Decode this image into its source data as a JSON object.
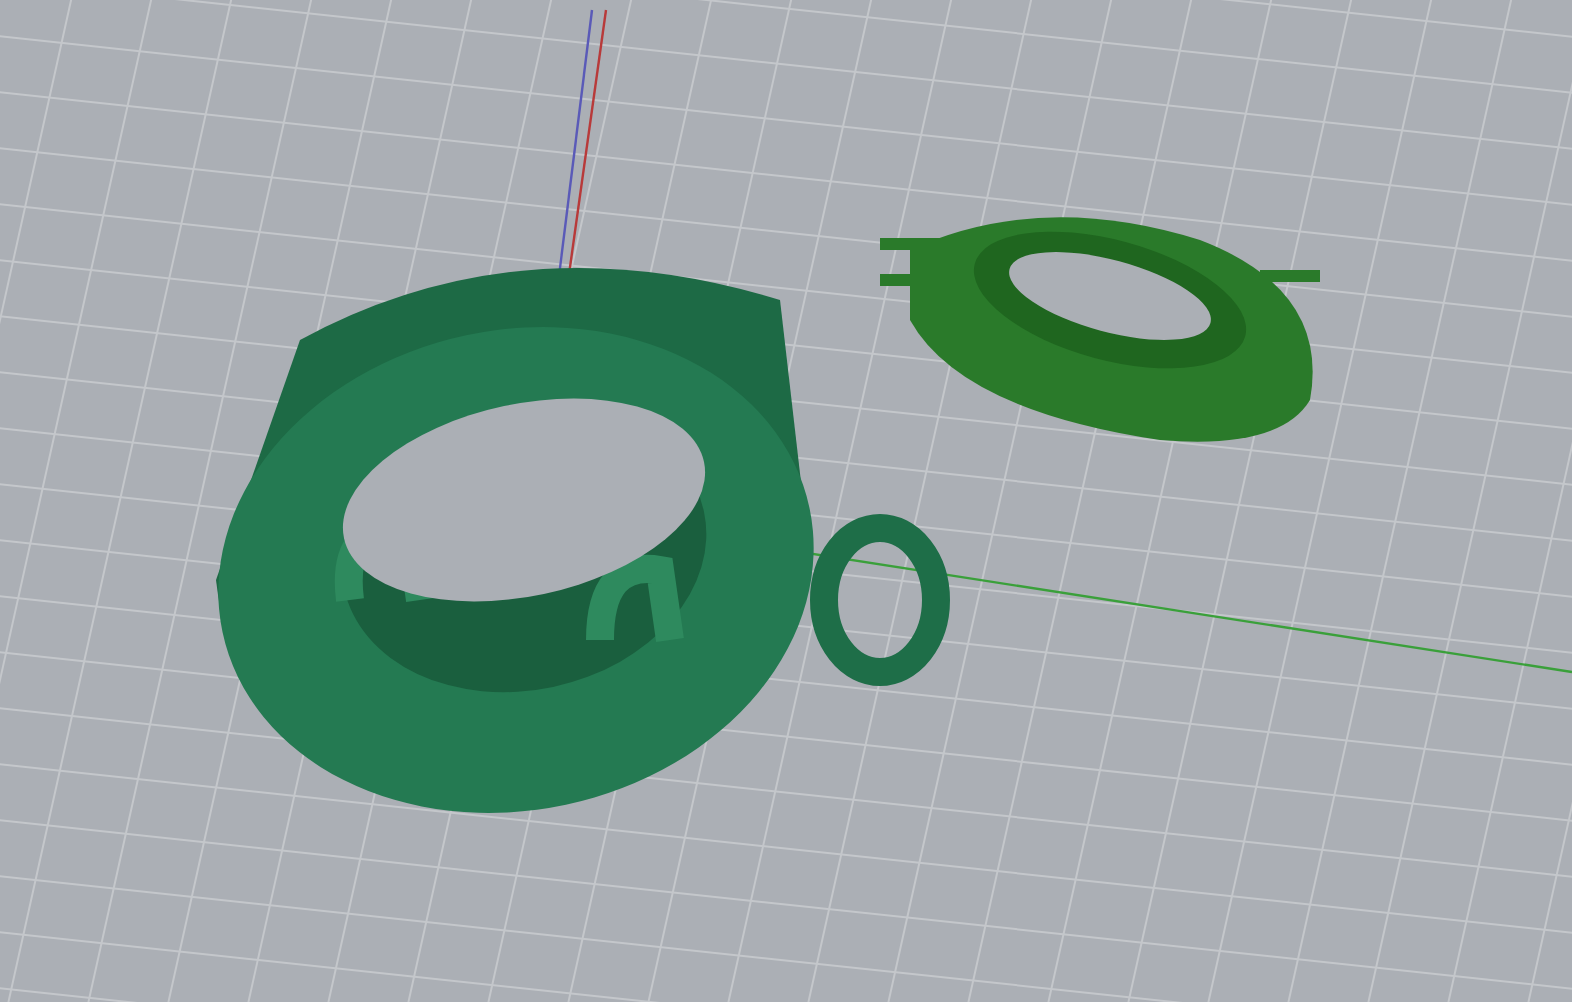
{
  "viewport": {
    "kind": "perspective",
    "grid": true,
    "axes": true
  }
}
